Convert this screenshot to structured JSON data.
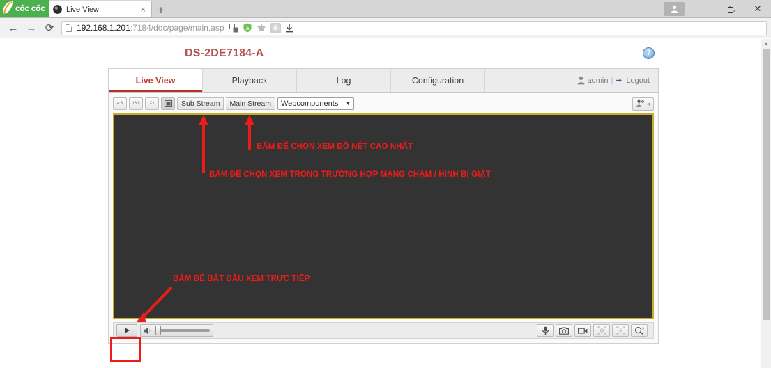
{
  "browser": {
    "brand": "cốc cốc",
    "tab": {
      "title": "Live View",
      "close_label": "×",
      "favicon": "camera-favicon"
    },
    "new_tab_label": "+",
    "window_controls": {
      "minimize": "—",
      "maximize": "❐",
      "close": "✕",
      "profile": "user-icon"
    },
    "nav": {
      "back": "←",
      "forward": "→",
      "reload": "⟳"
    },
    "url": {
      "host": "192.168.1.201",
      "rest": ":7184/doc/page/main.asp",
      "page_icon": "document-icon"
    },
    "url_icons": [
      "extension-icon",
      "adblock-icon",
      "bookmark-star-icon",
      "download-icon",
      "save-icon"
    ]
  },
  "page": {
    "device_title": "DS-2DE7184-A",
    "help_label": "?",
    "tabs": [
      {
        "label": "Live View",
        "active": true
      },
      {
        "label": "Playback",
        "active": false
      },
      {
        "label": "Log",
        "active": false
      },
      {
        "label": "Configuration",
        "active": false
      }
    ],
    "user": {
      "name": "admin",
      "separator": "|",
      "logout": "Logout"
    },
    "toolbar": {
      "ratio_buttons": [
        "4:3",
        "16:9",
        "X1"
      ],
      "fit_button": "fit-window-icon",
      "stream_buttons": [
        {
          "label": "Sub Stream",
          "selected": false
        },
        {
          "label": "Main Stream",
          "selected": false
        }
      ],
      "plugin_select": {
        "value": "Webcomponents",
        "caret": "▼"
      },
      "ptz": {
        "icon": "ptz-joystick-icon",
        "collapse": "«"
      }
    },
    "bottom_bar": {
      "play": "play-icon",
      "volume": {
        "icon": "speaker-muted-icon",
        "value": 0
      },
      "right_icons": [
        "microphone-icon",
        "snapshot-icon",
        "record-icon",
        "manual-track-icon",
        "auto-track-icon",
        "zoom-3d-icon"
      ]
    },
    "annotations": [
      {
        "id": "main-stream-note",
        "text": "BẤM ĐỂ CHỌN XEM ĐỘ NÉT CAO NHẤT"
      },
      {
        "id": "sub-stream-note",
        "text": "BẤM ĐỂ CHỌN XEM TRONG TRƯỜNG HỢP MẠNG CHẬM / HÌNH BỊ GIẬT"
      },
      {
        "id": "play-note",
        "text": "BẤM ĐỂ BẮT ĐẦU XEM TRỰC TIẾP"
      }
    ]
  },
  "colors": {
    "annotation_red": "#ee1b1b",
    "title_red": "#b0524f",
    "active_tab_red": "#b9322a",
    "video_bg": "#333333",
    "video_border": "#c9ab27",
    "brand_green": "#4caf50"
  }
}
